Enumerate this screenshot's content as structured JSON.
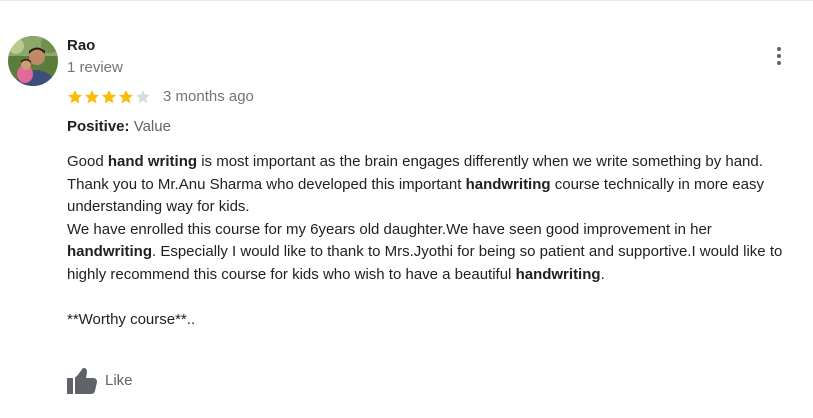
{
  "review": {
    "reviewer": {
      "name": "Rao",
      "review_count": "1 review",
      "avatar_icon": "profile-photo"
    },
    "rating": {
      "value": 4,
      "max": 5,
      "filled_color": "#fbbc04",
      "empty_color": "#dadce0"
    },
    "date": "3 months ago",
    "attribute": {
      "label": "Positive:",
      "value": " Value"
    },
    "body": {
      "p1": [
        {
          "text": "Good ",
          "bold": false
        },
        {
          "text": "hand writing",
          "bold": true
        },
        {
          "text": " is most important as the brain engages differently when we write something by hand.",
          "bold": false
        }
      ],
      "p2": [
        {
          "text": "Thank you to Mr.Anu Sharma who developed this important ",
          "bold": false
        },
        {
          "text": "handwriting",
          "bold": true
        },
        {
          "text": " course technically in more easy understanding way for kids.",
          "bold": false
        }
      ],
      "p3": [
        {
          "text": "We have enrolled this course for my 6years old daughter.We have seen good improvement in her ",
          "bold": false
        },
        {
          "text": "handwriting",
          "bold": true
        },
        {
          "text": ". Especially I would like to thank to Mrs.Jyothi for being so patient and supportive.I would like to highly recommend this course for kids who wish to have a beautiful ",
          "bold": false
        },
        {
          "text": "handwriting",
          "bold": true
        },
        {
          "text": ".",
          "bold": false
        }
      ],
      "p4": [
        {
          "text": "**Worthy course**..",
          "bold": false
        }
      ]
    },
    "actions": {
      "like_label": "Like",
      "like_icon": "thumb-up-icon",
      "more_icon": "more-vert-icon"
    }
  }
}
